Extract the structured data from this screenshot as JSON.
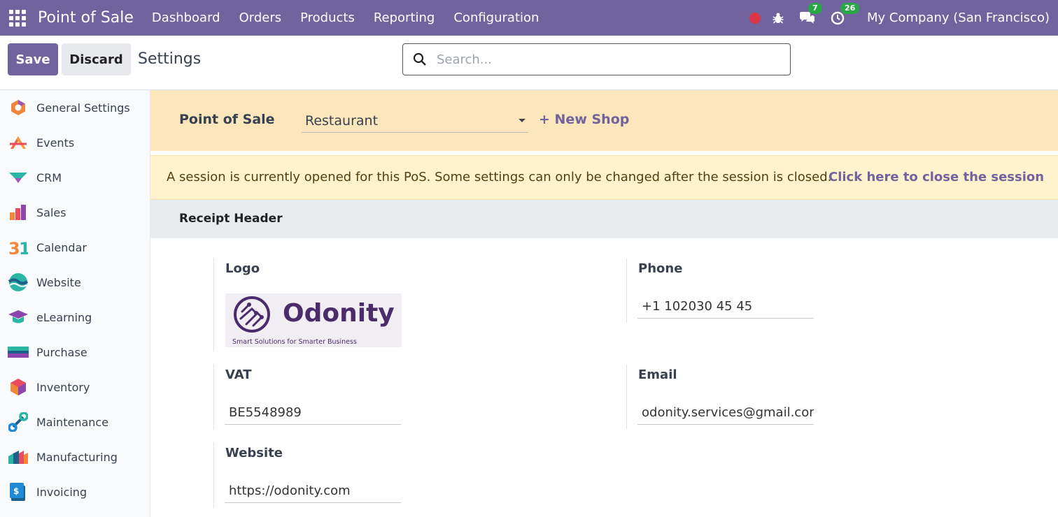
{
  "topbar": {
    "brand": "Point of Sale",
    "menu": [
      "Dashboard",
      "Orders",
      "Products",
      "Reporting",
      "Configuration"
    ],
    "messages_count": "7",
    "activities_count": "26",
    "company": "My Company (San Francisco)"
  },
  "control": {
    "save_label": "Save",
    "discard_label": "Discard",
    "page_title": "Settings",
    "search_placeholder": "Search..."
  },
  "sidebar": {
    "items": [
      {
        "label": "General Settings",
        "icon": "general-settings-icon"
      },
      {
        "label": "Events",
        "icon": "events-icon"
      },
      {
        "label": "CRM",
        "icon": "crm-icon"
      },
      {
        "label": "Sales",
        "icon": "sales-icon"
      },
      {
        "label": "Calendar",
        "icon": "calendar-icon"
      },
      {
        "label": "Website",
        "icon": "website-icon"
      },
      {
        "label": "eLearning",
        "icon": "elearning-icon"
      },
      {
        "label": "Purchase",
        "icon": "purchase-icon"
      },
      {
        "label": "Inventory",
        "icon": "inventory-icon"
      },
      {
        "label": "Maintenance",
        "icon": "maintenance-icon"
      },
      {
        "label": "Manufacturing",
        "icon": "manufacturing-icon"
      },
      {
        "label": "Invoicing",
        "icon": "invoicing-icon"
      }
    ]
  },
  "shop": {
    "label": "Point of Sale",
    "selected": "Restaurant",
    "new_shop": "+ New Shop"
  },
  "alert": {
    "message": "A session is currently opened for this PoS. Some settings can only be changed after the session is closed.",
    "link": "Click here to close the session"
  },
  "receipt_header": {
    "title": "Receipt Header",
    "logo_label": "Logo",
    "logo_text": "Odonity",
    "logo_tagline": "Smart Solutions for Smarter Business",
    "phone_label": "Phone",
    "phone_value": "+1 102030 45 45",
    "vat_label": "VAT",
    "vat_value": "BE5548989",
    "email_label": "Email",
    "email_value": "odonity.services@gmail.com",
    "website_label": "Website",
    "website_value": "https://odonity.com"
  },
  "colors": {
    "brand": "#71639e",
    "shopbar": "#fce6bb",
    "alert": "#fff3cd",
    "badge": "#28a745",
    "recording": "#dc3545"
  }
}
